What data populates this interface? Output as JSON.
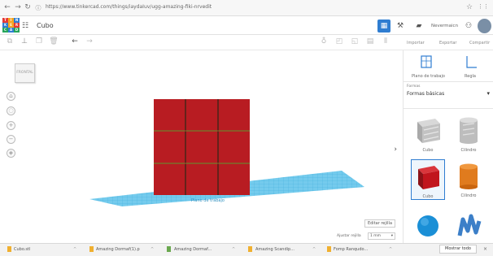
{
  "browser": {
    "url": "https://www.tinkercad.com/things/iaydaIuv/ugg-amazing-fiki-nrvedit",
    "back_icon": "back-arrow-icon",
    "forward_icon": "forward-arrow-icon",
    "reload_icon": "reload-icon"
  },
  "app": {
    "design_title": "Cubo",
    "header": {
      "user_label": "Nevermaicn"
    },
    "toolbar": {
      "import": "Importar",
      "export": "Exportar",
      "share": "Compartir"
    },
    "viewcube_label": "FRONTAL",
    "workplane_label": "Plano de trabajo",
    "bottom_controls": {
      "edit_grid": "Editar rejilla",
      "snap_label": "Ajustar rejilla",
      "snap_value": "1 mm"
    }
  },
  "panel": {
    "tools": [
      {
        "label": "Plano de trabajo"
      },
      {
        "label": "Regla"
      }
    ],
    "category_caption": "Formas",
    "category_value": "Formas básicas",
    "shapes": [
      {
        "label": "Cubo"
      },
      {
        "label": "Cilindro"
      },
      {
        "label": "Cubo"
      },
      {
        "label": "Cilindro"
      },
      {
        "label": ""
      },
      {
        "label": ""
      }
    ],
    "collapse_icon": "chevron-right-icon"
  },
  "downloads": [
    {
      "label": "Cubo.stl"
    },
    {
      "label": "Amazing Dormaf(1).p"
    },
    {
      "label": "Amazing Dormaf..."
    },
    {
      "label": "Amazing Scandip..."
    },
    {
      "label": "Fomp Ranqudo..."
    }
  ],
  "downloads_show_all": "Mostrar todo",
  "colors": {
    "cube_red": "#b81c22",
    "workplane_blue": "#6cc8ec",
    "orange_shape": "#e07b1e"
  }
}
